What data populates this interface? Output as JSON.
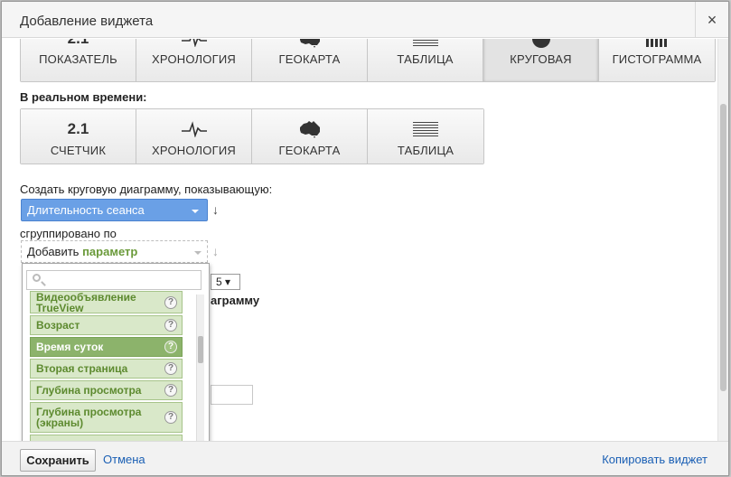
{
  "dialog": {
    "title": "Добавление виджета",
    "close_icon": "×"
  },
  "standard_types": [
    {
      "icon_text": "2.1",
      "label": "ПОКАЗАТЕЛЬ",
      "icon": "metric-icon"
    },
    {
      "icon_text": "",
      "label": "ХРОНОЛОГИЯ",
      "icon": "timeline-icon"
    },
    {
      "icon_text": "",
      "label": "ГЕОКАРТА",
      "icon": "geomap-icon"
    },
    {
      "icon_text": "",
      "label": "ТАБЛИЦА",
      "icon": "table-icon"
    },
    {
      "icon_text": "",
      "label": "КРУГОВАЯ",
      "icon": "pie-icon",
      "active": true
    },
    {
      "icon_text": "",
      "label": "ГИСТОГРАММА",
      "icon": "bar-icon"
    }
  ],
  "realtime_label": "В реальном времени:",
  "realtime_types": [
    {
      "icon_text": "2.1",
      "label": "СЧЕТЧИК",
      "icon": "counter-icon"
    },
    {
      "icon_text": "",
      "label": "ХРОНОЛОГИЯ",
      "icon": "timeline-icon"
    },
    {
      "icon_text": "",
      "label": "ГЕОКАРТА",
      "icon": "geomap-icon"
    },
    {
      "icon_text": "",
      "label": "ТАБЛИЦА",
      "icon": "table-icon"
    }
  ],
  "config": {
    "create_label": "Создать круговую диаграмму, показывающую:",
    "metric_value": "Длительность сеанса",
    "sort_arrow": "↓",
    "grouped_label": "сгруппировано по",
    "dimension_prefix": "Добавить",
    "dimension_highlight": "параметр"
  },
  "dropdown": {
    "search_placeholder": "",
    "items": [
      {
        "label": "Видеообъявление TrueView",
        "selected": false
      },
      {
        "label": "Возраст",
        "selected": false
      },
      {
        "label": "Время суток",
        "selected": true
      },
      {
        "label": "Вторая страница",
        "selected": false
      },
      {
        "label": "Глубина просмотра",
        "selected": false
      },
      {
        "label": "Глубина просмотра (экраны)",
        "selected": false
      }
    ]
  },
  "behind": {
    "select_value": "5",
    "text_partial": "аграмму"
  },
  "footer": {
    "save_label": "Сохранить",
    "cancel_label": "Отмена",
    "copy_label": "Копировать виджет"
  }
}
